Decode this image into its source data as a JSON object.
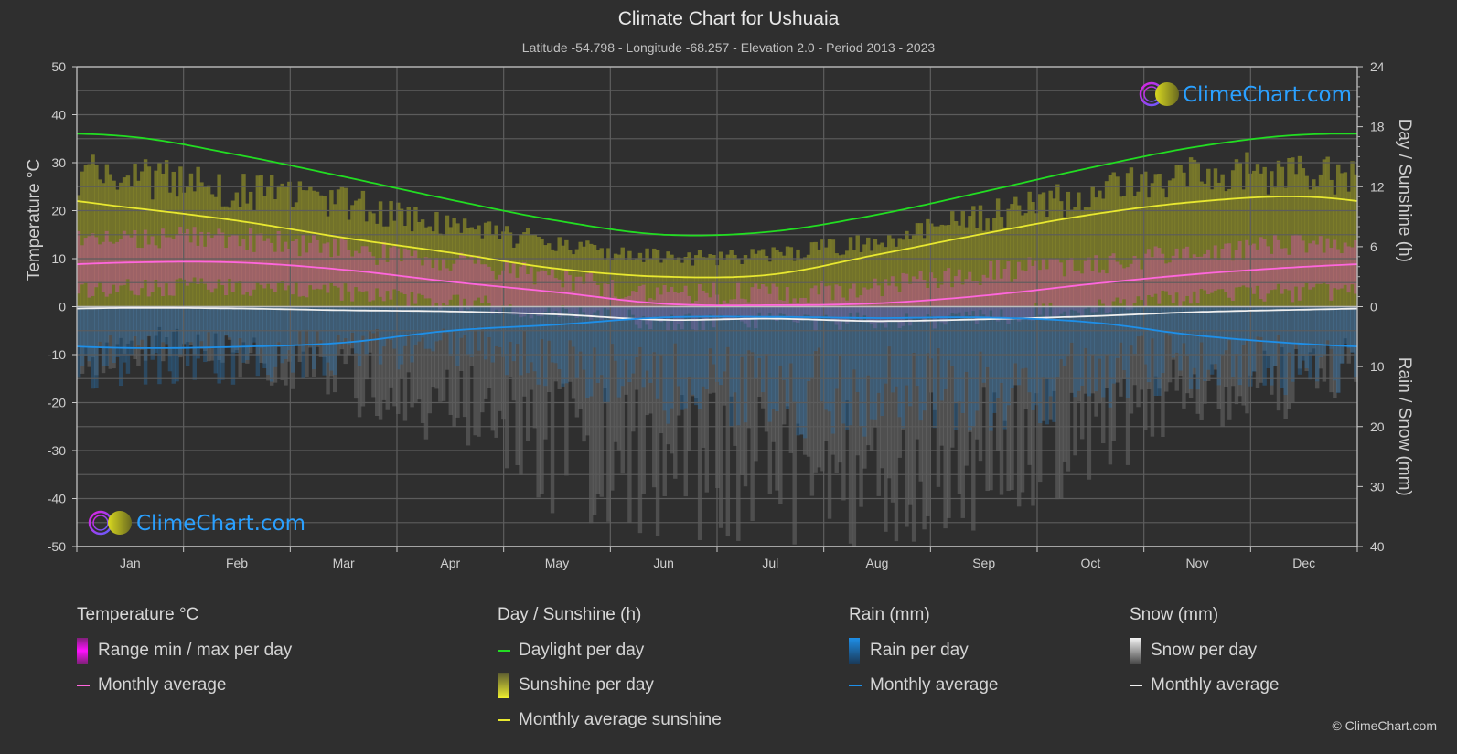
{
  "header": {
    "title": "Climate Chart for Ushuaia",
    "subtitle": "Latitude -54.798 - Longitude -68.257 - Elevation 2.0 - Period 2013 - 2023"
  },
  "watermark": {
    "text": "ClimeChart.com"
  },
  "copyright": "© ClimeChart.com",
  "colors": {
    "background": "#2f2f2f",
    "daylight": "#22dd22",
    "sunshine_avg": "#e8e830",
    "sunshine_bar": "#9a9a30",
    "temp_avg": "#ff66dd",
    "temp_range": "#d050b0",
    "rain_avg": "#1e8fe8",
    "rain_bar": "#2a6aa0",
    "snow_avg": "#f0f0f0",
    "snow_bar": "#8a8a8a",
    "watermark": "#2aa0ff"
  },
  "legend": {
    "groups": [
      {
        "title": "Temperature °C",
        "items": [
          {
            "label": "Range min / max per day",
            "type": "bar",
            "color_key": "temp"
          },
          {
            "label": "Monthly average",
            "type": "line",
            "color_key": "temp_avg"
          }
        ]
      },
      {
        "title": "Day / Sunshine (h)",
        "items": [
          {
            "label": "Daylight per day",
            "type": "line",
            "color_key": "daylight"
          },
          {
            "label": "Sunshine per day",
            "type": "bar",
            "color_key": "sun"
          },
          {
            "label": "Monthly average sunshine",
            "type": "line",
            "color_key": "sunshine_avg"
          }
        ]
      },
      {
        "title": "Rain (mm)",
        "items": [
          {
            "label": "Rain per day",
            "type": "bar",
            "color_key": "rain"
          },
          {
            "label": "Monthly average",
            "type": "line",
            "color_key": "rain_avg"
          }
        ]
      },
      {
        "title": "Snow (mm)",
        "items": [
          {
            "label": "Snow per day",
            "type": "bar",
            "color_key": "snow"
          },
          {
            "label": "Monthly average",
            "type": "line",
            "color_key": "snow_avg"
          }
        ]
      }
    ]
  },
  "chart_data": {
    "type": "line",
    "title": "Climate Chart for Ushuaia",
    "subtitle": "Latitude -54.798 - Longitude -68.257 - Elevation 2.0 - Period 2013 - 2023",
    "categories": [
      "Jan",
      "Feb",
      "Mar",
      "Apr",
      "May",
      "Jun",
      "Jul",
      "Aug",
      "Sep",
      "Oct",
      "Nov",
      "Dec"
    ],
    "axes": {
      "left": {
        "label": "Temperature °C",
        "range": [
          -50,
          50
        ],
        "ticks": [
          50,
          40,
          30,
          20,
          10,
          0,
          -10,
          -20,
          -30,
          -40,
          -50
        ]
      },
      "right_top": {
        "label": "Day / Sunshine (h)",
        "range": [
          0,
          24
        ],
        "ticks": [
          24,
          18,
          12,
          6,
          0
        ]
      },
      "right_bottom": {
        "label": "Rain / Snow (mm)",
        "range": [
          0,
          40
        ],
        "ticks": [
          0,
          10,
          20,
          30,
          40
        ]
      }
    },
    "grid": true,
    "series": [
      {
        "name": "Daylight per day",
        "axis": "right_top",
        "unit": "h",
        "values": [
          17.0,
          15.2,
          13.0,
          10.7,
          8.6,
          7.2,
          7.5,
          9.2,
          11.5,
          13.9,
          16.0,
          17.2
        ]
      },
      {
        "name": "Monthly average sunshine",
        "axis": "right_top",
        "unit": "h",
        "values": [
          9.9,
          8.6,
          6.9,
          5.4,
          3.8,
          3.0,
          3.2,
          5.2,
          7.3,
          9.2,
          10.5,
          11.0
        ]
      },
      {
        "name": "Temperature monthly average",
        "axis": "left",
        "unit": "°C",
        "values": [
          9.2,
          9.2,
          7.7,
          5.2,
          3.0,
          0.6,
          0.3,
          0.7,
          2.3,
          4.7,
          6.8,
          8.3
        ]
      },
      {
        "name": "Temperature daily max (approx)",
        "axis": "left",
        "unit": "°C",
        "values": [
          14,
          14,
          12,
          9,
          6,
          3,
          3,
          4,
          7,
          9,
          11,
          13
        ]
      },
      {
        "name": "Temperature daily min (approx)",
        "axis": "left",
        "unit": "°C",
        "values": [
          4,
          4,
          3,
          1,
          -1,
          -3,
          -3,
          -3,
          -2,
          0,
          2,
          3
        ]
      },
      {
        "name": "Rain monthly average",
        "axis": "right_bottom",
        "unit": "mm",
        "values": [
          6.9,
          6.7,
          6.0,
          4.0,
          3.0,
          1.8,
          1.7,
          1.9,
          1.8,
          2.6,
          4.8,
          6.2
        ]
      },
      {
        "name": "Snow monthly average",
        "axis": "right_bottom",
        "unit": "mm",
        "values": [
          0.2,
          0.3,
          0.6,
          0.8,
          1.3,
          2.2,
          2.0,
          2.4,
          2.1,
          1.6,
          0.9,
          0.5
        ]
      },
      {
        "name": "Sunshine per day (bar envelope)",
        "axis": "right_top",
        "unit": "h",
        "values": [
          14.5,
          13.0,
          11.5,
          9.0,
          7.0,
          5.5,
          5.8,
          7.5,
          10.0,
          12.5,
          14.5,
          15.0
        ]
      },
      {
        "name": "Rain per day (bar envelope)",
        "axis": "right_bottom",
        "unit": "mm",
        "values": [
          14,
          13,
          12,
          10,
          14,
          20,
          22,
          22,
          22,
          18,
          14,
          15
        ]
      },
      {
        "name": "Snow per day (bar envelope)",
        "axis": "right_bottom",
        "unit": "mm",
        "values": [
          10,
          12,
          18,
          25,
          35,
          40,
          40,
          40,
          38,
          30,
          22,
          18
        ]
      }
    ]
  }
}
